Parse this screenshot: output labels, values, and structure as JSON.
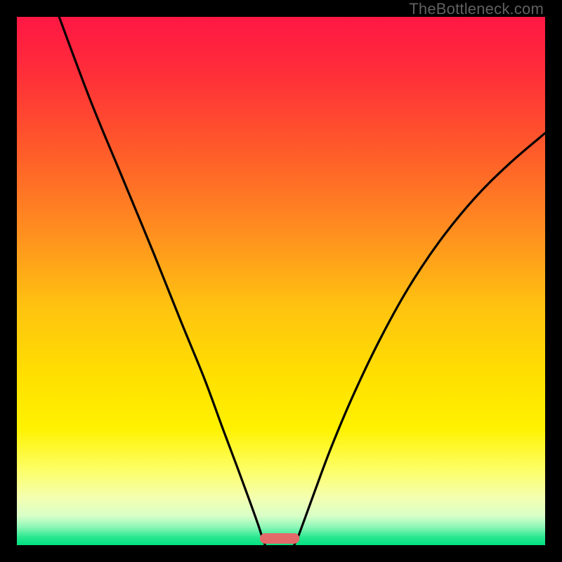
{
  "watermark": "TheBottleneck.com",
  "chart_data": {
    "type": "line",
    "title": "",
    "xlabel": "",
    "ylabel": "",
    "xlim": [
      0,
      100
    ],
    "ylim": [
      0,
      100
    ],
    "gradient_stops": [
      {
        "offset": 0.0,
        "color": "#ff1744"
      },
      {
        "offset": 0.1,
        "color": "#ff2c3a"
      },
      {
        "offset": 0.25,
        "color": "#ff5a2a"
      },
      {
        "offset": 0.4,
        "color": "#ff8c20"
      },
      {
        "offset": 0.55,
        "color": "#ffc310"
      },
      {
        "offset": 0.68,
        "color": "#ffe000"
      },
      {
        "offset": 0.78,
        "color": "#fff200"
      },
      {
        "offset": 0.86,
        "color": "#fdff6a"
      },
      {
        "offset": 0.91,
        "color": "#f4ffb0"
      },
      {
        "offset": 0.945,
        "color": "#d8ffc8"
      },
      {
        "offset": 0.965,
        "color": "#90f7b8"
      },
      {
        "offset": 0.985,
        "color": "#28e88f"
      },
      {
        "offset": 1.0,
        "color": "#00e080"
      }
    ],
    "series": [
      {
        "name": "left-curve",
        "points": [
          {
            "x": 8.0,
            "y": 100.0
          },
          {
            "x": 14.0,
            "y": 84.0
          },
          {
            "x": 20.0,
            "y": 69.5
          },
          {
            "x": 26.0,
            "y": 55.0
          },
          {
            "x": 31.0,
            "y": 42.5
          },
          {
            "x": 35.5,
            "y": 31.5
          },
          {
            "x": 39.0,
            "y": 22.0
          },
          {
            "x": 42.0,
            "y": 14.0
          },
          {
            "x": 44.2,
            "y": 8.0
          },
          {
            "x": 45.8,
            "y": 3.5
          },
          {
            "x": 46.6,
            "y": 1.0
          },
          {
            "x": 47.0,
            "y": 0.0
          }
        ]
      },
      {
        "name": "right-curve",
        "points": [
          {
            "x": 52.5,
            "y": 0.0
          },
          {
            "x": 53.2,
            "y": 1.5
          },
          {
            "x": 54.5,
            "y": 5.0
          },
          {
            "x": 56.5,
            "y": 10.5
          },
          {
            "x": 59.5,
            "y": 18.5
          },
          {
            "x": 63.5,
            "y": 28.0
          },
          {
            "x": 68.5,
            "y": 38.5
          },
          {
            "x": 74.0,
            "y": 48.5
          },
          {
            "x": 80.0,
            "y": 57.5
          },
          {
            "x": 86.5,
            "y": 65.5
          },
          {
            "x": 93.0,
            "y": 72.0
          },
          {
            "x": 100.0,
            "y": 78.0
          }
        ]
      }
    ],
    "marker": {
      "name": "bottleneck-marker",
      "x_start": 46.0,
      "x_end": 53.5,
      "color": "#e46a6a"
    }
  }
}
